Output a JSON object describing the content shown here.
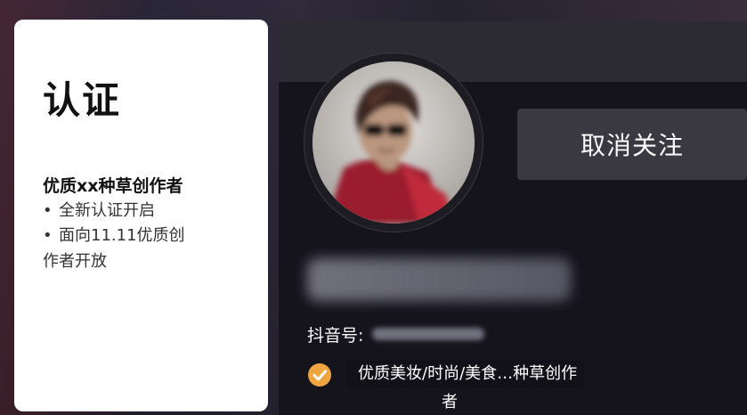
{
  "card": {
    "title": "认证",
    "subtitle": "优质xx种草创作者",
    "bullets": [
      "全新认证开启",
      "面向11.11优质创"
    ],
    "bullet_continuation": "作者开放"
  },
  "profile": {
    "unfollow_label": "取消关注",
    "douyin_label": "抖音号:",
    "cert_line1": "优质美妆/时尚/美食…种草创作",
    "cert_line2": "者"
  },
  "colors": {
    "badge_check": "#f0a640",
    "panel_bg": "#15141d",
    "button_bg": "#3a3941"
  },
  "icons": {
    "check": "check-icon",
    "bullet": "bullet-dot-icon"
  }
}
